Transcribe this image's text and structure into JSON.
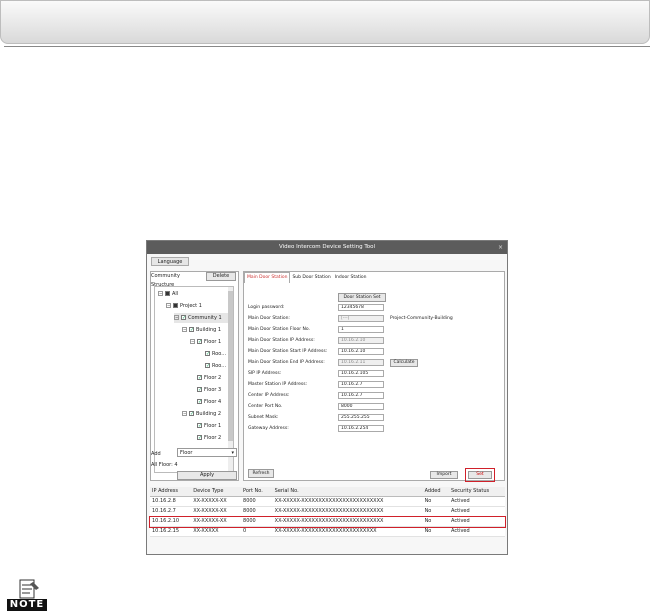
{
  "window": {
    "title": "Video Intercom Device Setting Tool",
    "close": "×",
    "language_button": "Language"
  },
  "left": {
    "tab_community": "Community Structure",
    "delete_button": "Delete",
    "tree": [
      {
        "label": "All"
      },
      {
        "label": "Project 1"
      },
      {
        "label": "Community 1"
      },
      {
        "label": "Building 1"
      },
      {
        "label": "Floor 1"
      },
      {
        "label": "Roo..."
      },
      {
        "label": "Roo..."
      },
      {
        "label": "Floor 2"
      },
      {
        "label": "Floor 3"
      },
      {
        "label": "Floor 4"
      },
      {
        "label": "Building 2"
      },
      {
        "label": "Floor 1"
      },
      {
        "label": "Floor 2"
      }
    ],
    "add_label": "Add",
    "add_value": "Floor",
    "all_floor": "All Floor: 4",
    "apply_button": "Apply"
  },
  "right": {
    "tabs": [
      "Main Door Station",
      "Sub Door Station",
      "Indoor Station"
    ],
    "door_station_button": "Door Station Set",
    "fields": [
      {
        "label": "Login password:",
        "value": "12345678"
      },
      {
        "label": "Main Door Station:",
        "value": "[---]"
      },
      {
        "label": "Main Door Station Floor No.",
        "value": "1"
      },
      {
        "label": "Main Door Station IP Address:",
        "value": "10.16.2.10"
      },
      {
        "label": "Main Door Station Start IP Address:",
        "value": "10.16.2.10"
      },
      {
        "label": "Main Door Station End IP Address:",
        "value": "10.16.2.11"
      },
      {
        "label": "SIP IP Address:",
        "value": "10.16.2.105"
      },
      {
        "label": "Master Station IP Address:",
        "value": "10.16.2.7"
      },
      {
        "label": "Center IP Address:",
        "value": "10.16.2.7"
      },
      {
        "label": "Center Port No.",
        "value": "8000"
      },
      {
        "label": "Subnet Mask:",
        "value": "255.255.255"
      },
      {
        "label": "Gateway Address:",
        "value": "10.16.2.254"
      }
    ],
    "hint": "Project-Community-Building",
    "calculate_button": "Calculate",
    "refresh_button": "Refresh",
    "import_button": "Import",
    "set_button": "Set"
  },
  "table": {
    "columns": [
      "IP Address",
      "Device Type",
      "Port No.",
      "Serial No.",
      "Added",
      "Security Status"
    ],
    "rows": [
      [
        "10.16.2.8",
        "XX-XXXXX-XX",
        "8000",
        "XX-XXXXX-XXXXXXXXXXXXXXXXXXXXXXXX",
        "No",
        "Actived"
      ],
      [
        "10.16.2.7",
        "XX-XXXXX-XX",
        "8000",
        "XX-XXXXX-XXXXXXXXXXXXXXXXXXXXXXXX",
        "No",
        "Actived"
      ],
      [
        "10.16.2.10",
        "XX-XXXXX-XX",
        "8000",
        "XX-XXXXX-XXXXXXXXXXXXXXXXXXXXXXXX",
        "No",
        "Actived"
      ],
      [
        "10.16.2.15",
        "XX-XXXXX",
        "0",
        "XX-XXXXX-XXXXXXXXXXXXXXXXXXXXXX",
        "No",
        "Actived"
      ]
    ]
  },
  "note": {
    "label": "NOTE",
    "icon": "note-icon"
  },
  "colors": {
    "highlight": "#d0202a",
    "titlebar": "#5c5c5c"
  }
}
